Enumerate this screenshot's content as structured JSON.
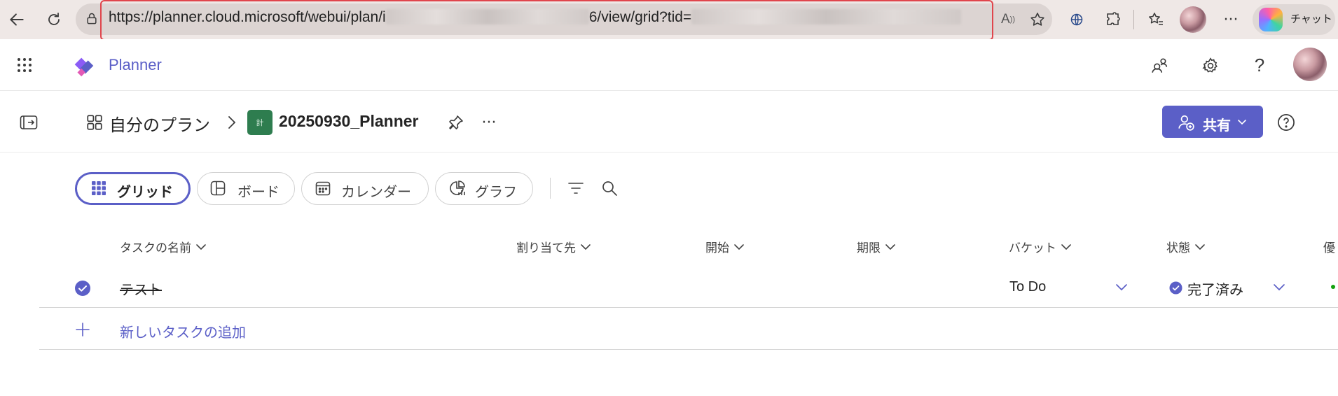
{
  "browser": {
    "url_prefix": "https://planner.cloud.microsoft/webui/plan/i",
    "url_middle": "6/view/grid?tid=",
    "chat_label": "チャット"
  },
  "app": {
    "title": "Planner"
  },
  "plan": {
    "breadcrumb_root": "自分のプラン",
    "tile_text": "計",
    "name": "20250930_Planner",
    "share_label": "共有"
  },
  "views": [
    {
      "label": "グリッド",
      "active": true
    },
    {
      "label": "ボード",
      "active": false
    },
    {
      "label": "カレンダー",
      "active": false
    },
    {
      "label": "グラフ",
      "active": false
    }
  ],
  "columns": [
    {
      "label": "タスクの名前"
    },
    {
      "label": "割り当て先"
    },
    {
      "label": "開始"
    },
    {
      "label": "期限"
    },
    {
      "label": "バケット"
    },
    {
      "label": "状態"
    },
    {
      "label": "優"
    }
  ],
  "tasks": [
    {
      "name": "テスト",
      "bucket": "To Do",
      "status": "完了済み",
      "completed": true
    }
  ],
  "add_task_label": "新しいタスクの追加",
  "colors": {
    "accent": "#5b5fc7",
    "browser_bg": "#efe8e6",
    "url_highlight": "#e0454c",
    "plan_tile": "#2e7d4f"
  }
}
